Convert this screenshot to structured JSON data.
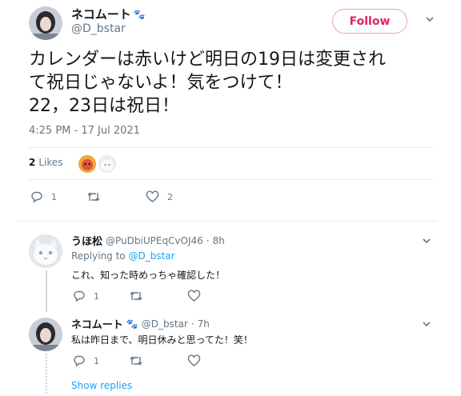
{
  "tweet": {
    "author_name": "ネコムート",
    "author_handle": "@D_bstar",
    "follow_label": "Follow",
    "text_lines": [
      "カレンダーは赤いけど明日の19日は変更され",
      "て祝日じゃないよ！気をつけて！",
      "22，23日は祝日！"
    ],
    "timestamp": "4:25 PM - 17 Jul 2021",
    "likes_count": "2",
    "likes_label": "Likes",
    "reply_count": "1",
    "retweet_count": "",
    "like_count": "2"
  },
  "replies": [
    {
      "author_name": "うほ松",
      "author_handle": "@PuDbiUPEqCvOJ46",
      "separator": "·",
      "time": "8h",
      "replying_prefix": "Replying to",
      "replying_to": "@D_bstar",
      "text": "これ、知った時めっちゃ確認した！",
      "reply_count": "1"
    },
    {
      "author_name": "ネコムート",
      "author_handle": "@D_bstar",
      "separator": "·",
      "time": "7h",
      "text": "私は昨日まで、明日休みと思ってた！笑！",
      "reply_count": "1"
    }
  ],
  "show_replies_label": "Show replies",
  "icons": {
    "paw": "🐾",
    "reply": "reply-icon",
    "retweet": "retweet-icon",
    "like": "heart-icon",
    "caret": "chevron-down-icon"
  },
  "colors": {
    "follow_accent": "#e0245e",
    "link": "#1da1f2",
    "muted": "#657786"
  }
}
